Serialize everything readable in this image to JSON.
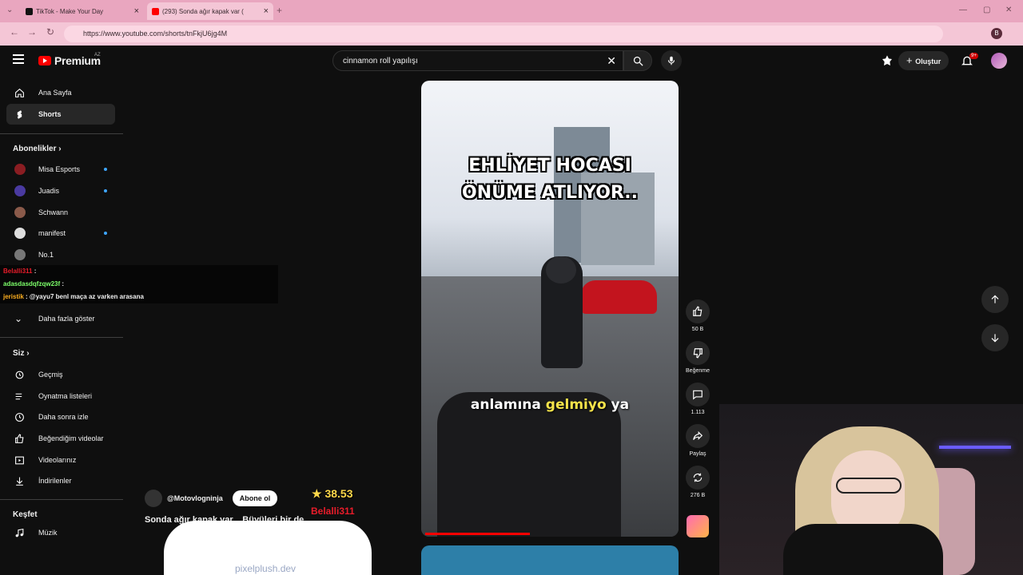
{
  "browser": {
    "tabs": [
      {
        "title": "TikTok - Make Your Day"
      },
      {
        "title": "(293) Sonda ağır kapak var ("
      }
    ],
    "url": "https://www.youtube.com/shorts/tnFkjU6jg4M"
  },
  "header": {
    "brand": "Premium",
    "country": "AZ",
    "search_value": "cinnamon roll yapılışı",
    "create_label": "Oluştur",
    "notif_count": "9+"
  },
  "sidebar": {
    "main": [
      {
        "label": "Ana Sayfa",
        "icon": "home-icon"
      },
      {
        "label": "Shorts",
        "icon": "shorts-icon"
      }
    ],
    "subs_header": "Abonelikler",
    "subs": [
      {
        "label": "Misa Esports",
        "color": "#8a1d22",
        "dot": true
      },
      {
        "label": "Juadis",
        "color": "#4a3aa0",
        "dot": true
      },
      {
        "label": "Schwann",
        "color": "#8a5a4a",
        "dot": false
      },
      {
        "label": "manifest",
        "color": "#dddddd",
        "dot": true
      },
      {
        "label": "No.1",
        "color": "#777777",
        "dot": false
      }
    ],
    "more_label": "Daha fazla göster",
    "you_header": "Siz",
    "you": [
      {
        "label": "Geçmiş",
        "icon": "history-icon"
      },
      {
        "label": "Oynatma listeleri",
        "icon": "playlist-icon"
      },
      {
        "label": "Daha sonra izle",
        "icon": "clock-icon"
      },
      {
        "label": "Beğendiğim videolar",
        "icon": "thumb-icon"
      },
      {
        "label": "Videolarınız",
        "icon": "video-icon"
      },
      {
        "label": "İndirilenler",
        "icon": "download-icon"
      }
    ],
    "explore_header": "Keşfet",
    "explore": [
      {
        "label": "Müzik",
        "icon": "music-icon"
      }
    ]
  },
  "chat": [
    {
      "user": "Belalli311",
      "msg": ":",
      "color": "#e81c2a"
    },
    {
      "user": "adasdasdqfzqw23f",
      "msg": ":",
      "color": "#7dff6a"
    },
    {
      "user": "jeristik",
      "msg": ": @yayu7 benl maça az varken arasana",
      "color": "#ffb020"
    }
  ],
  "short": {
    "caption_line1": "EHLİYET HOCASI",
    "caption_line2": "ÖNÜME ATLIYOR..",
    "subtitle_a": "anlamına",
    "subtitle_b": "gelmiyo",
    "subtitle_c": "ya",
    "progress": 0.42,
    "channel": "@Motovlogninja",
    "subscribe_label": "Abone ol",
    "title": "Sonda ağır kapak var... Büyüleri bir de ..."
  },
  "actions": {
    "like_count": "50 B",
    "dislike_label": "Beğenme",
    "comment_count": "1.113",
    "share_label": "Paylaş",
    "remix_count": "276 B"
  },
  "overlay": {
    "star_value": "38.53",
    "star_user": "Belalli311",
    "watermark": "pixelplush.dev"
  }
}
